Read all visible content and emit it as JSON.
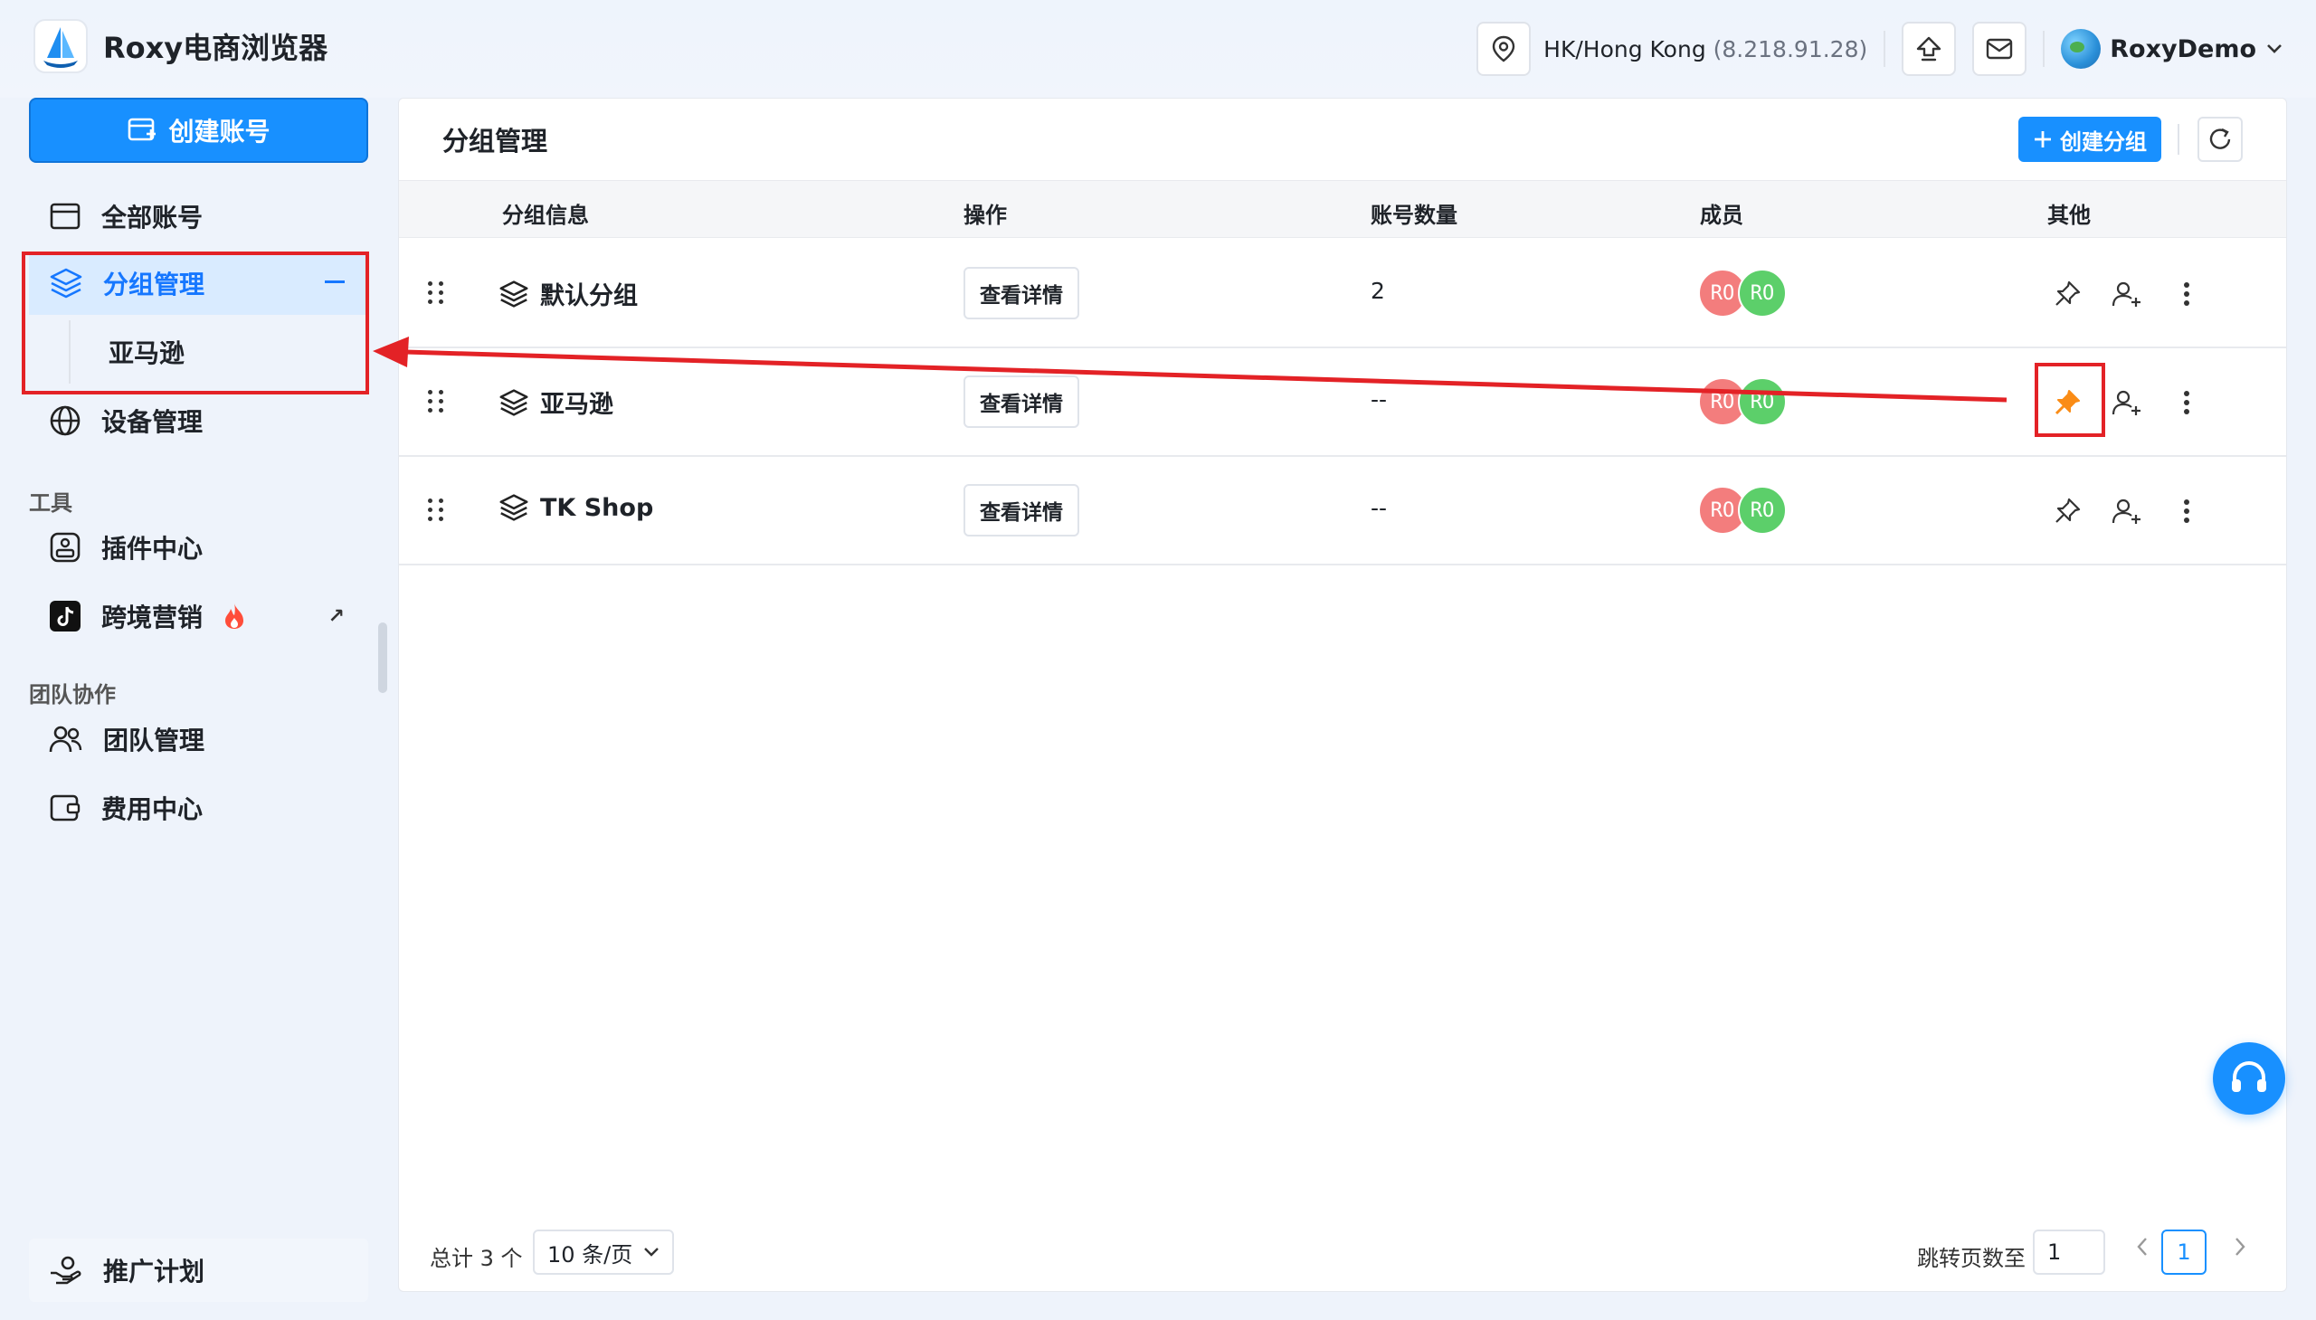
{
  "app": {
    "title": "Roxy电商浏览器"
  },
  "header": {
    "location": "HK/Hong Kong",
    "ip": "(8.218.91.28)",
    "username": "RoxyDemo"
  },
  "sidebar": {
    "create_account": "创建账号",
    "items": [
      {
        "label": "全部账号"
      },
      {
        "label": "分组管理"
      },
      {
        "label": "亚马逊"
      },
      {
        "label": "设备管理"
      }
    ],
    "section_tools": "工具",
    "tools": [
      {
        "label": "插件中心"
      },
      {
        "label": "跨境营销"
      }
    ],
    "section_team": "团队协作",
    "team": [
      {
        "label": "团队管理"
      },
      {
        "label": "费用中心"
      }
    ],
    "promo": "推广计划"
  },
  "main": {
    "title": "分组管理",
    "create_group": "创建分组",
    "columns": [
      "分组信息",
      "操作",
      "账号数量",
      "成员",
      "其他"
    ],
    "rows": [
      {
        "name": "默认分组",
        "action": "查看详情",
        "count": "2",
        "members": [
          "RO",
          "RO"
        ],
        "pinned": false
      },
      {
        "name": "亚马逊",
        "action": "查看详情",
        "count": "--",
        "members": [
          "RO",
          "RO"
        ],
        "pinned": true
      },
      {
        "name": "TK Shop",
        "action": "查看详情",
        "count": "--",
        "members": [
          "RO",
          "RO"
        ],
        "pinned": false
      }
    ],
    "pagination": {
      "total": "总计 3 个",
      "page_size": "10 条/页",
      "jump_label": "跳转页数至",
      "jump_value": "1",
      "current_page": "1"
    }
  },
  "colors": {
    "accent": "#1890ff",
    "annotation": "#e32226",
    "pin_active": "#fa8c16",
    "avatar_red": "#f37d7d",
    "avatar_green": "#5ccf6a"
  },
  "icons": [
    "logo-icon",
    "location-icon",
    "upload-icon",
    "mail-icon",
    "globe-avatar",
    "chevron-down-icon",
    "add-account-icon",
    "card-icon",
    "layers-icon",
    "globe-icon",
    "plugin-icon",
    "tiktok-icon",
    "fire-icon",
    "external-link-icon",
    "team-icon",
    "wallet-icon",
    "promo-icon",
    "plus-icon",
    "refresh-icon",
    "drag-handle-icon",
    "pin-icon",
    "add-member-icon",
    "more-icon",
    "headset-icon"
  ]
}
